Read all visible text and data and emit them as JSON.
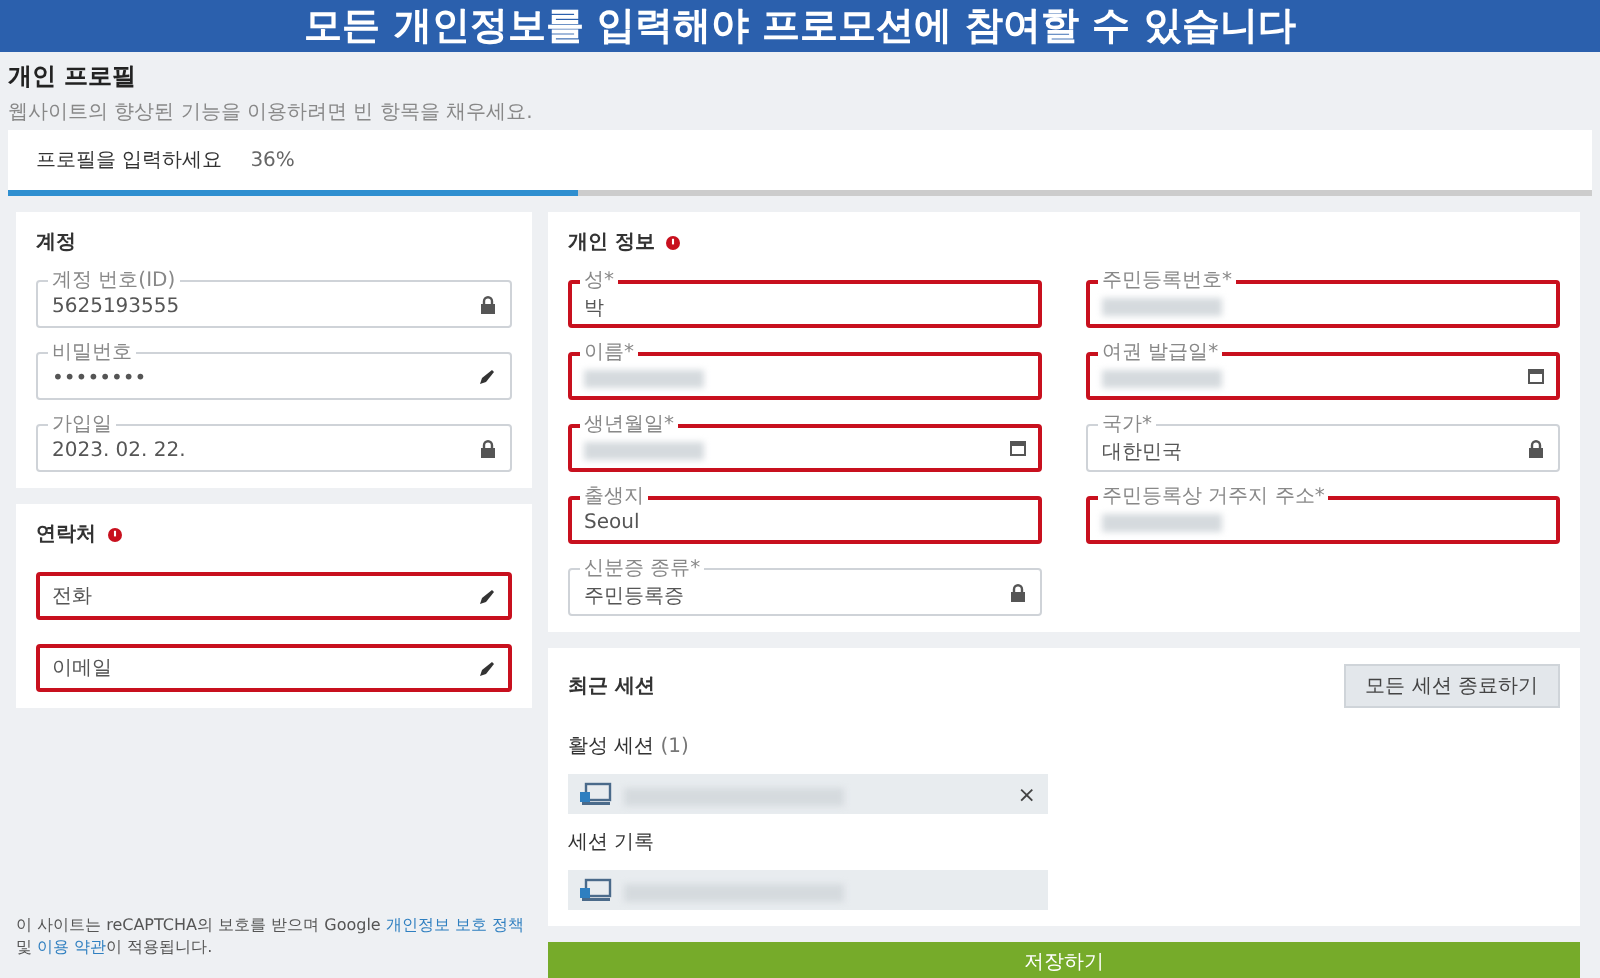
{
  "banner": {
    "text": "모든 개인정보를 입력해야 프로모션에 참여할 수 있습니다"
  },
  "header": {
    "title": "개인 프로필",
    "subtitle": "웹사이트의 향상된 기능을 이용하려면 빈 항목을 채우세요."
  },
  "progress": {
    "label": "프로필을 입력하세요",
    "reading": "36%",
    "level": 0.36
  },
  "account": {
    "title": "계정",
    "fields": [
      {
        "label": "계정 번호(ID)",
        "value": "5625193555",
        "kind": "locked",
        "highlighted": false
      },
      {
        "label": "비밀번호",
        "value": "••••••••",
        "kind": "editable",
        "highlighted": false
      },
      {
        "label": "가입일",
        "value": "2023. 02. 22.",
        "kind": "locked",
        "highlighted": false
      }
    ]
  },
  "contacts": {
    "title": "연락처",
    "alert": true,
    "fields": [
      {
        "placeholder": "전화",
        "kind": "editable",
        "highlighted": true
      },
      {
        "placeholder": "이메일",
        "kind": "editable",
        "highlighted": true
      }
    ]
  },
  "personal": {
    "title": "개인 정보",
    "alert": true,
    "fields": [
      {
        "label": "성*",
        "value": "박",
        "kind": "text",
        "highlighted": true
      },
      {
        "label": "주민등록번호*",
        "redacted": true,
        "kind": "text",
        "highlighted": true
      },
      {
        "label": "이름*",
        "redacted": true,
        "kind": "text",
        "highlighted": true
      },
      {
        "label": "여권 발급일*",
        "redacted": true,
        "kind": "date",
        "highlighted": true
      },
      {
        "label": "생년월일*",
        "redacted": true,
        "kind": "date",
        "highlighted": true
      },
      {
        "label": "국가*",
        "value": "대한민국",
        "kind": "locked",
        "highlighted": false
      },
      {
        "label": "출생지",
        "value": "Seoul",
        "kind": "text",
        "highlighted": true
      },
      {
        "label": "주민등록상 거주지 주소*",
        "redacted": true,
        "kind": "text",
        "highlighted": true
      },
      {
        "label": "신분증 종류*",
        "value": "주민등록증",
        "kind": "locked",
        "highlighted": false
      }
    ]
  },
  "sessions": {
    "title": "최근 세션",
    "end_all_button": "모든 세션 종료하기",
    "active_title": "활성 세션",
    "active_count": "(1)",
    "active": [
      {
        "kind": "computer",
        "close_symbol": "×"
      }
    ],
    "history_title": "세션 기록",
    "history": [
      {
        "kind": "computer"
      }
    ]
  },
  "save_button": "저장하기",
  "footer": [
    {
      "text": "이 사이트는 reCAPTCHA의 보호를 받으며 Google ",
      "link": false
    },
    {
      "text": "개인정보 보호 정책",
      "link": true
    },
    {
      "text": " 및 ",
      "link": false
    },
    {
      "text": "이용 약관",
      "link": true
    },
    {
      "text": "이 적용됩니다.",
      "link": false
    }
  ]
}
